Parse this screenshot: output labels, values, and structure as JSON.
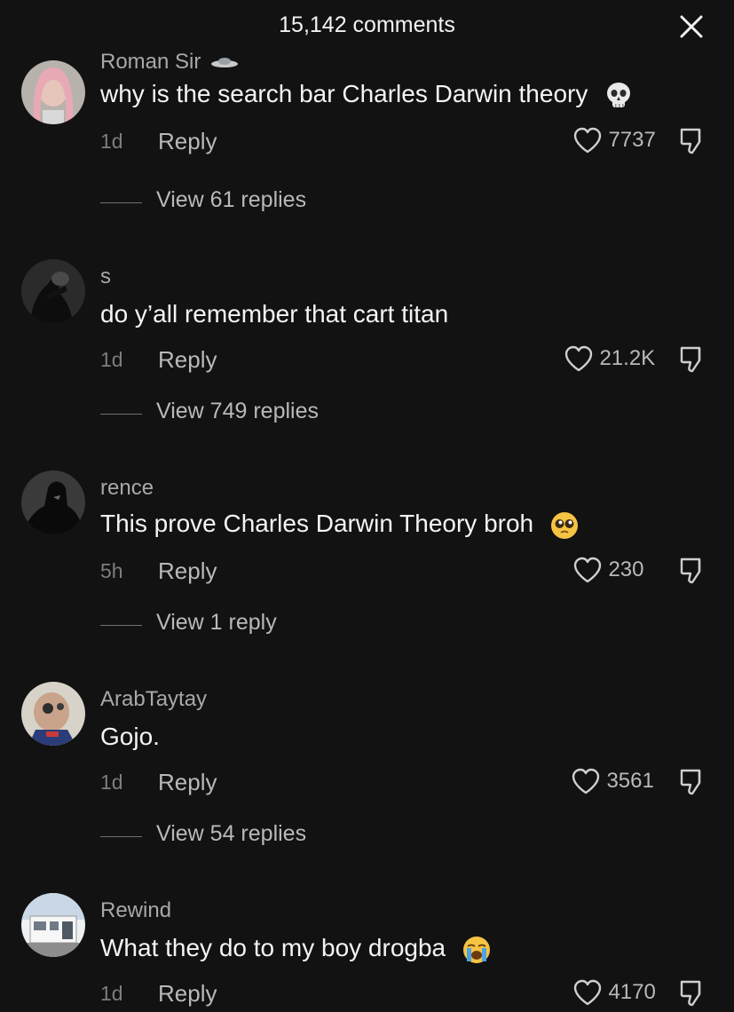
{
  "header": {
    "title": "15,142 comments",
    "close_icon": "close-icon"
  },
  "comments": [
    {
      "username": "Roman Sir",
      "text": "why is the search bar Charles Darwin theory",
      "emoji": "skull-emoji",
      "time": "1d",
      "reply_label": "Reply",
      "likes": "7737",
      "view_replies": "View 61 replies"
    },
    {
      "username": "s",
      "text": "do y’all remember that cart titan",
      "emoji": "",
      "time": "1d",
      "reply_label": "Reply",
      "likes": "21.2K",
      "view_replies": "View 749 replies"
    },
    {
      "username": "rence",
      "text": "This prove Charles Darwin Theory broh",
      "emoji": "pleading-face-emoji",
      "time": "5h",
      "reply_label": "Reply",
      "likes": "230",
      "view_replies": "View 1 reply"
    },
    {
      "username": "ArabTaytay",
      "text": "Gojo.",
      "emoji": "",
      "time": "1d",
      "reply_label": "Reply",
      "likes": "3561",
      "view_replies": "View 54 replies"
    },
    {
      "username": "Rewind",
      "text": "What they do to my boy drogba",
      "emoji": "crying-face-emoji",
      "time": "1d",
      "reply_label": "Reply",
      "likes": "4170",
      "view_replies": ""
    }
  ],
  "colors": {
    "background": "#121212",
    "text_primary": "#f4f4f4",
    "text_secondary": "#a8a8a8",
    "text_muted": "#7d7d7d"
  }
}
